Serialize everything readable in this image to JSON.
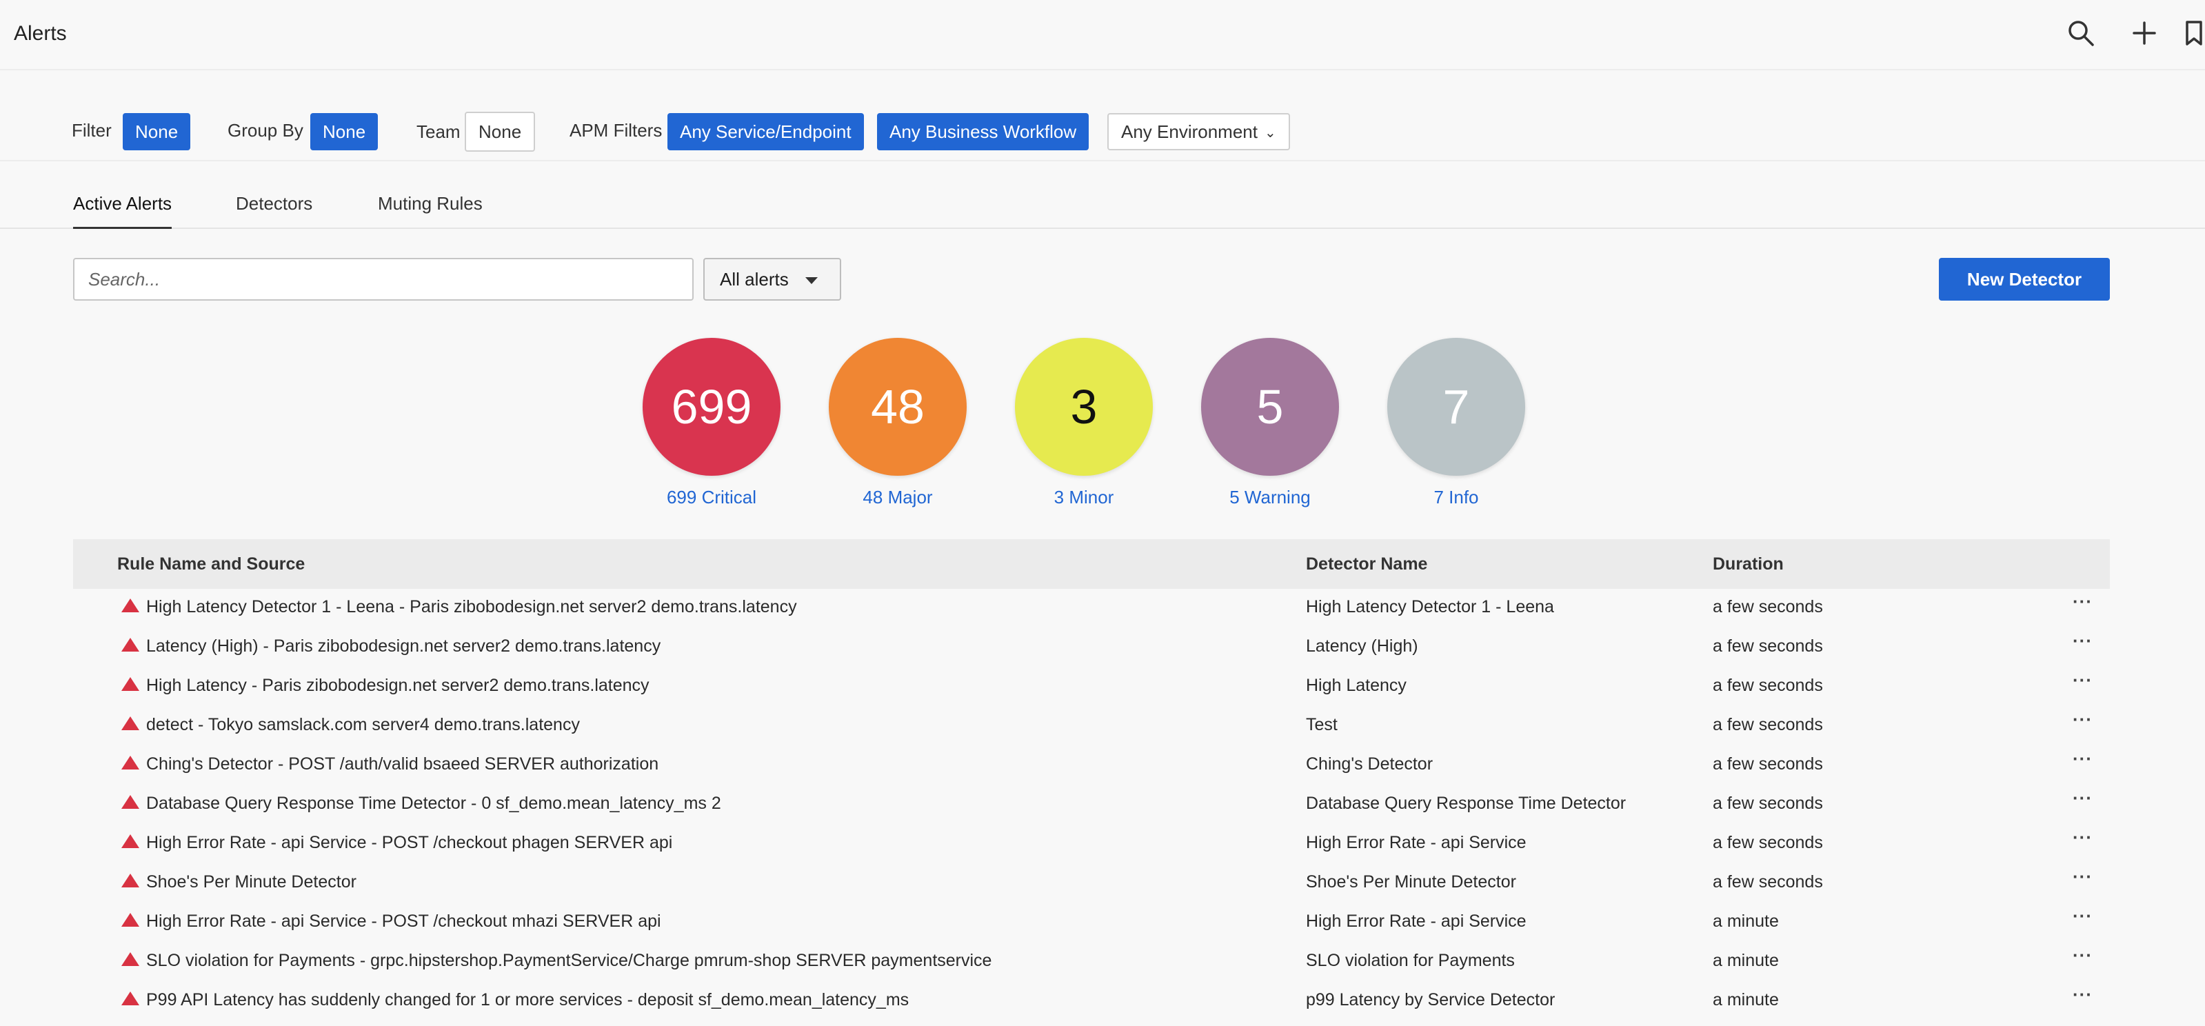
{
  "header": {
    "title": "Alerts",
    "icons": [
      "search-icon",
      "plus-icon",
      "bookmark-icon"
    ]
  },
  "filters": {
    "filter_label": "Filter",
    "filter_value": "None",
    "groupby_label": "Group By",
    "groupby_value": "None",
    "team_label": "Team",
    "team_value": "None",
    "apm_label": "APM Filters",
    "apm_service": "Any Service/Endpoint",
    "apm_workflow": "Any Business Workflow",
    "environment": "Any Environment"
  },
  "tabs": [
    {
      "label": "Active Alerts",
      "active": true
    },
    {
      "label": "Detectors",
      "active": false
    },
    {
      "label": "Muting Rules",
      "active": false
    }
  ],
  "toolbar": {
    "search_placeholder": "Search...",
    "alert_filter": "All alerts",
    "new_detector": "New Detector"
  },
  "severity": [
    {
      "count": "699",
      "label": "699 Critical",
      "color": "#d9344f",
      "text_color": "#ffffff"
    },
    {
      "count": "48",
      "label": "48 Major",
      "color": "#f08633",
      "text_color": "#ffffff"
    },
    {
      "count": "3",
      "label": "3 Minor",
      "color": "#e6ea4f",
      "text_color": "#111111"
    },
    {
      "count": "5",
      "label": "5 Warning",
      "color": "#a3789c",
      "text_color": "#ffffff"
    },
    {
      "count": "7",
      "label": "7 Info",
      "color": "#bac4c7",
      "text_color": "#ffffff"
    }
  ],
  "table": {
    "columns": [
      "Rule Name and Source",
      "Detector Name",
      "Duration"
    ],
    "rows": [
      {
        "rule": "High Latency Detector 1 - Leena - Paris zibobodesign.net server2 demo.trans.latency",
        "detector": "High Latency Detector 1 - Leena",
        "duration": "a few seconds"
      },
      {
        "rule": "Latency (High) - Paris zibobodesign.net server2 demo.trans.latency",
        "detector": "Latency (High)",
        "duration": "a few seconds"
      },
      {
        "rule": "High Latency - Paris zibobodesign.net server2 demo.trans.latency",
        "detector": "High Latency",
        "duration": "a few seconds"
      },
      {
        "rule": "detect - Tokyo samslack.com server4 demo.trans.latency",
        "detector": "Test",
        "duration": "a few seconds"
      },
      {
        "rule": "Ching's Detector - POST /auth/valid bsaeed SERVER authorization",
        "detector": "Ching's Detector",
        "duration": "a few seconds"
      },
      {
        "rule": "Database Query Response Time Detector - 0 sf_demo.mean_latency_ms 2",
        "detector": "Database Query Response Time Detector",
        "duration": "a few seconds"
      },
      {
        "rule": "High Error Rate - api Service - POST /checkout phagen SERVER api",
        "detector": "High Error Rate - api Service",
        "duration": "a few seconds"
      },
      {
        "rule": "Shoe's Per Minute Detector",
        "detector": "Shoe's Per Minute Detector",
        "duration": "a few seconds"
      },
      {
        "rule": "High Error Rate - api Service - POST /checkout mhazi SERVER api",
        "detector": "High Error Rate - api Service",
        "duration": "a minute"
      },
      {
        "rule": "SLO violation for Payments - grpc.hipstershop.PaymentService/Charge pmrum-shop SERVER paymentservice",
        "detector": "SLO violation for Payments",
        "duration": "a minute"
      },
      {
        "rule": "P99 API Latency has suddenly changed for 1 or more services - deposit sf_demo.mean_latency_ms",
        "detector": "p99 Latency by Service Detector",
        "duration": "a minute"
      }
    ],
    "row_menu": "···"
  },
  "colors": {
    "accent": "#2166d3",
    "critical": "#d83242"
  }
}
